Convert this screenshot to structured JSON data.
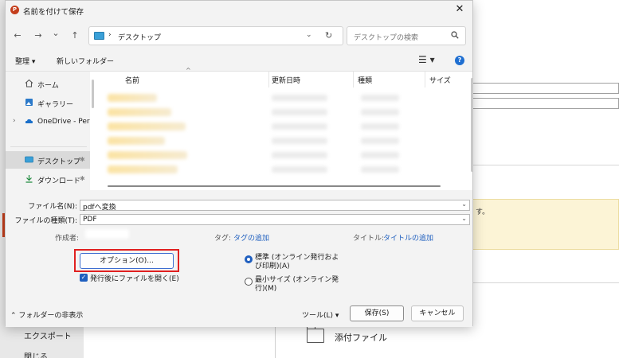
{
  "background": {
    "notice_text": "す。",
    "export_label": "エクスポート",
    "close_label": "閉じる",
    "attach_label": "添付ファイル"
  },
  "dialog": {
    "app_icon_letter": "P",
    "title": "名前を付けて保存",
    "close_glyph": "✕"
  },
  "nav": {
    "back_glyph": "←",
    "forward_glyph": "→",
    "recent_glyph": "⌄",
    "up_glyph": "↑",
    "address_separator": "›",
    "address_path": "デスクトップ",
    "address_dropdown_glyph": "⌄",
    "refresh_glyph": "↻",
    "search_placeholder": "デスクトップの検索"
  },
  "toolbar": {
    "organize_label": "整理 ▾",
    "new_folder_label": "新しいフォルダー",
    "view_glyph": "☰ ▾",
    "help_glyph": "?"
  },
  "sidebar": {
    "items": [
      {
        "label": "ホーム",
        "icon": "home-icon"
      },
      {
        "label": "ギャラリー",
        "icon": "gallery-icon"
      },
      {
        "label": "OneDrive - Perso",
        "icon": "cloud-icon"
      },
      {
        "label": "デスクトップ",
        "icon": "desktop-icon"
      },
      {
        "label": "ダウンロード",
        "icon": "download-icon"
      }
    ],
    "expand_glyph": "›",
    "pin_glyph": "📌"
  },
  "filelist": {
    "columns": [
      "名前",
      "更新日時",
      "種類",
      "サイズ"
    ],
    "sort_glyph": "^",
    "row_count": 6
  },
  "form": {
    "filename_label": "ファイル名(N):",
    "filename_value": "pdfへ変換",
    "filetype_label": "ファイルの種類(T):",
    "filetype_value": "PDF",
    "author_label": "作成者:",
    "tags_label": "タグ:",
    "tags_link": "タグの追加",
    "title_label": "タイトル:",
    "title_link": "タイトルの追加",
    "options_button": "オプション(O)...",
    "open_after_publish": "発行後にファイルを開く(E)",
    "radio_standard": "標準 (オンライン発行および印刷)(A)",
    "radio_minimum": "最小サイズ (オンライン発行)(M)",
    "hide_folders": "⌃  フォルダーの非表示",
    "tools_label": "ツール(L)    ▾",
    "save_button": "保存(S)",
    "cancel_button": "キャンセル",
    "checkmark": "✓"
  }
}
